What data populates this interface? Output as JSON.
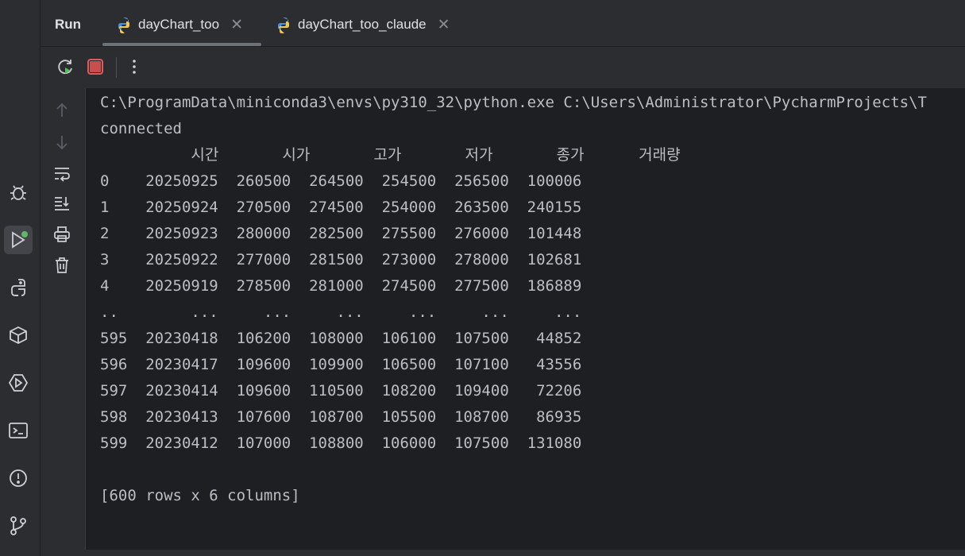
{
  "tool_window": {
    "title": "Run",
    "tabs": [
      {
        "label": "dayChart_too",
        "active": true
      },
      {
        "label": "dayChart_too_claude",
        "active": false
      }
    ]
  },
  "left_strip": [
    "bug-icon",
    "run-icon",
    "python-console-icon",
    "python-packages-icon",
    "services-icon",
    "terminal-icon",
    "problems-icon",
    "git-icon"
  ],
  "toolbar": [
    "rerun-icon",
    "stop-icon",
    "more-icon"
  ],
  "side_tools": [
    "scroll-up-icon",
    "scroll-down-icon",
    "soft-wrap-icon",
    "scroll-to-end-icon",
    "print-icon",
    "clear-icon"
  ],
  "console": {
    "command": "C:\\ProgramData\\miniconda3\\envs\\py310_32\\python.exe C:\\Users\\Administrator\\PycharmProjects\\T",
    "status": "connected",
    "header": "          시간       시가       고가       저가       종가      거래량",
    "rows": [
      "0    20250925  260500  264500  254500  256500  100006",
      "1    20250924  270500  274500  254000  263500  240155",
      "2    20250923  280000  282500  275500  276000  101448",
      "3    20250922  277000  281500  273000  278000  102681",
      "4    20250919  278500  281000  274500  277500  186889",
      "..        ...     ...     ...     ...     ...     ...",
      "595  20230418  106200  108000  106100  107500   44852",
      "596  20230417  109600  109900  106500  107100   43556",
      "597  20230414  109600  110500  108200  109400   72206",
      "598  20230413  107600  108700  105500  108700   86935",
      "599  20230412  107000  108800  106000  107500  131080"
    ],
    "summary": "[600 rows x 6 columns]"
  },
  "colors": {
    "background": "#1e1f22",
    "panel": "#2b2d30",
    "text": "#bcbec4",
    "stop_red": "#db5c5c",
    "run_green": "#5fb865"
  }
}
